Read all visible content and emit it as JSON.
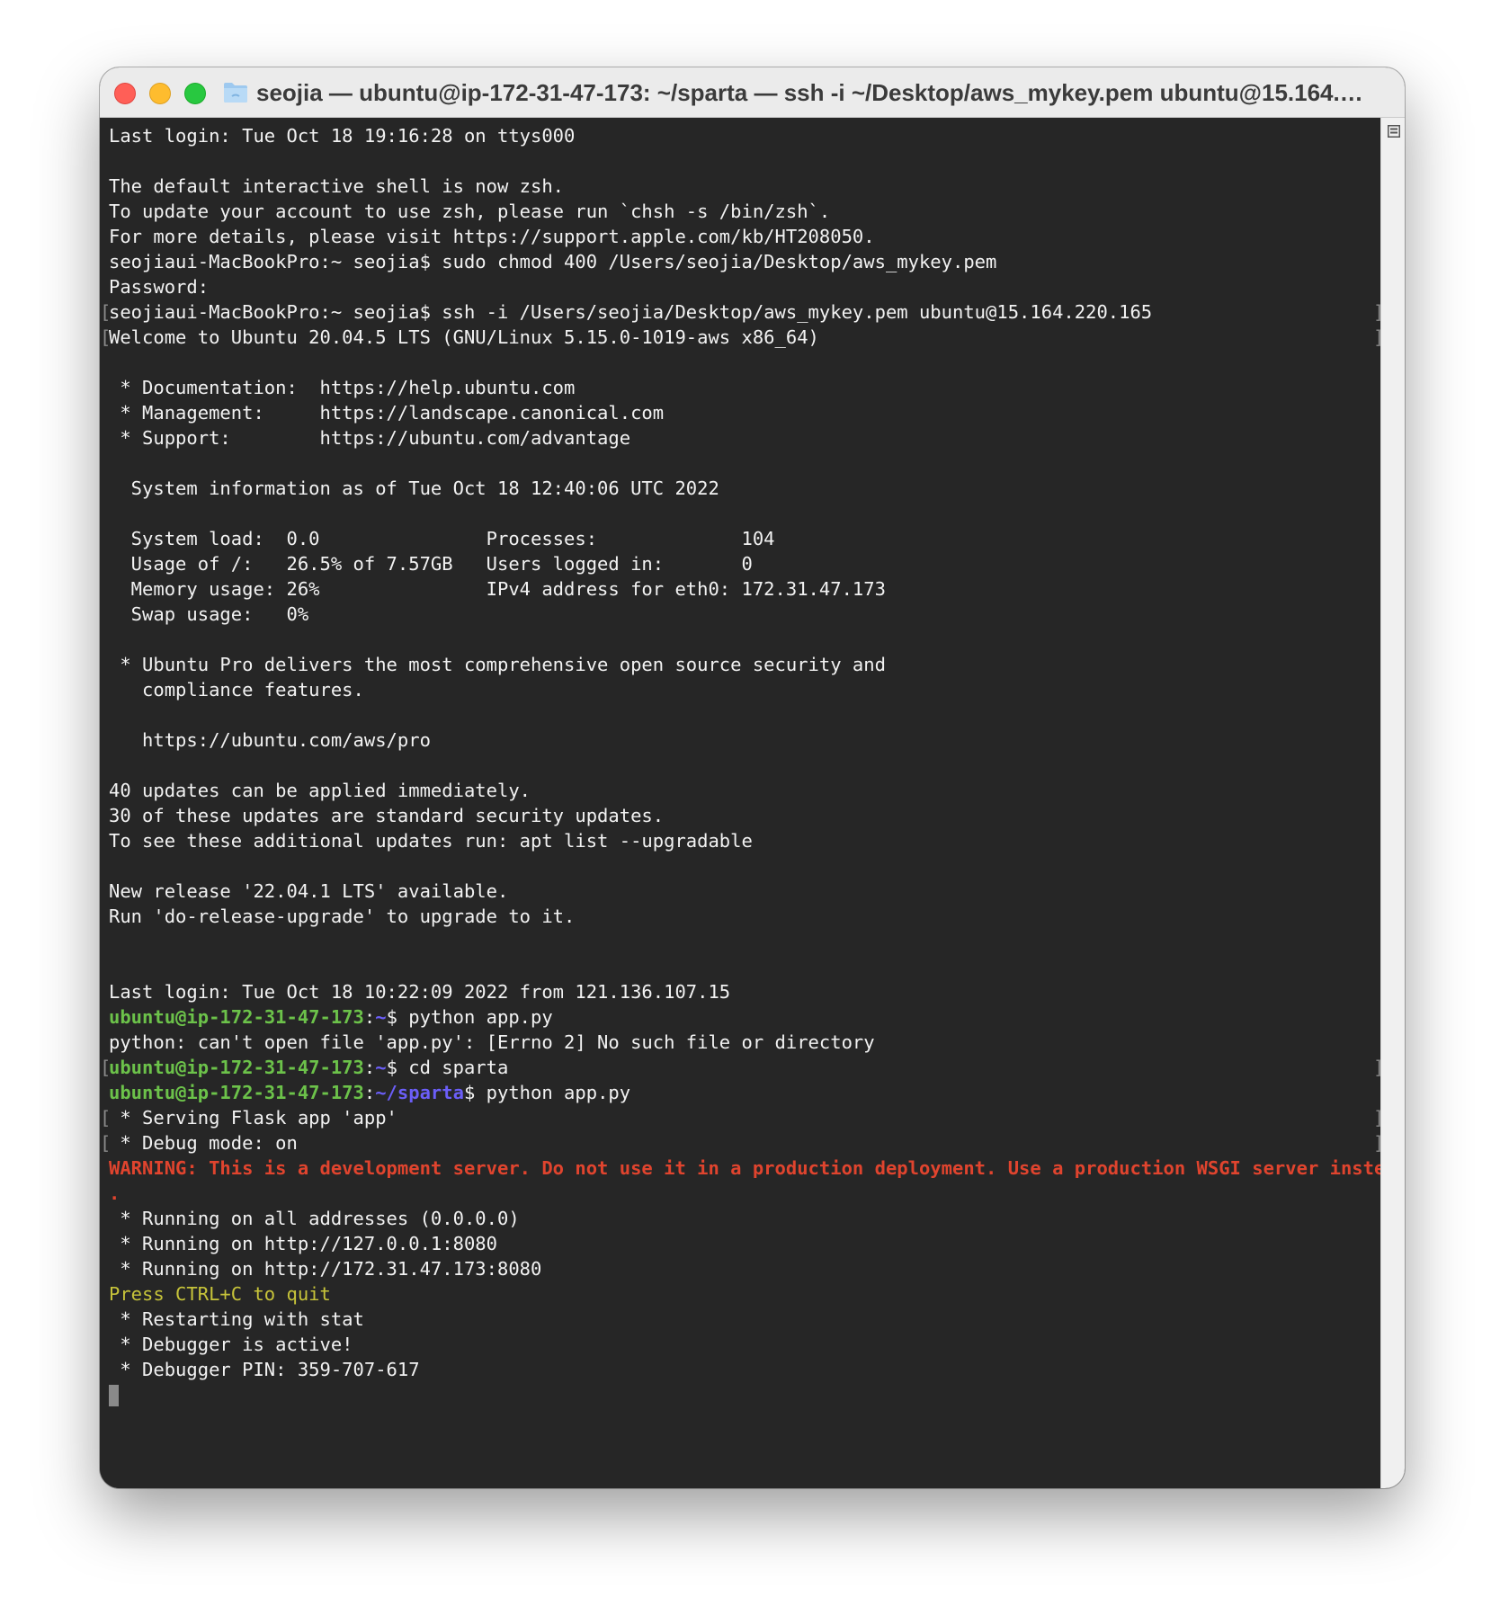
{
  "window": {
    "title": "seojia — ubuntu@ip-172-31-47-173: ~/sparta — ssh -i ~/Desktop/aws_mykey.pem ubuntu@15.164.…",
    "folder_icon": "folder-icon",
    "bookmark_icon": "marks-list-icon"
  },
  "colors": {
    "prompt_user": "#6cc24a",
    "prompt_path": "#6b5ef8",
    "warning": "#e0442e",
    "press_ctrl_c": "#c7c43a",
    "background": "#262626",
    "foreground": "#f2f2f2"
  },
  "terminal": {
    "l01": "Last login: Tue Oct 18 19:16:28 on ttys000",
    "l02": "",
    "l03": "The default interactive shell is now zsh.",
    "l04": "To update your account to use zsh, please run `chsh -s /bin/zsh`.",
    "l05": "For more details, please visit https://support.apple.com/kb/HT208050.",
    "l06": "seojiaui-MacBookPro:~ seojia$ sudo chmod 400 /Users/seojia/Desktop/aws_mykey.pem",
    "l07": "Password:",
    "l08": "seojiaui-MacBookPro:~ seojia$ ssh -i /Users/seojia/Desktop/aws_mykey.pem ubuntu@15.164.220.165",
    "l09": "Welcome to Ubuntu 20.04.5 LTS (GNU/Linux 5.15.0-1019-aws x86_64)",
    "l10": "",
    "l11": " * Documentation:  https://help.ubuntu.com",
    "l12": " * Management:     https://landscape.canonical.com",
    "l13": " * Support:        https://ubuntu.com/advantage",
    "l14": "",
    "l15": "  System information as of Tue Oct 18 12:40:06 UTC 2022",
    "l16": "",
    "l17": "  System load:  0.0               Processes:             104",
    "l18": "  Usage of /:   26.5% of 7.57GB   Users logged in:       0",
    "l19": "  Memory usage: 26%               IPv4 address for eth0: 172.31.47.173",
    "l20": "  Swap usage:   0%",
    "l21": "",
    "l22": " * Ubuntu Pro delivers the most comprehensive open source security and",
    "l23": "   compliance features.",
    "l24": "",
    "l25": "   https://ubuntu.com/aws/pro",
    "l26": "",
    "l27": "40 updates can be applied immediately.",
    "l28": "30 of these updates are standard security updates.",
    "l29": "To see these additional updates run: apt list --upgradable",
    "l30": "",
    "l31": "New release '22.04.1 LTS' available.",
    "l32": "Run 'do-release-upgrade' to upgrade to it.",
    "l33": "",
    "l34": "",
    "l35": "Last login: Tue Oct 18 10:22:09 2022 from 121.136.107.15",
    "l36": {
      "user": "ubuntu@ip-172-31-47-173",
      "sep": ":",
      "path": "~",
      "cmd": "$ python app.py"
    },
    "l37": "python: can't open file 'app.py': [Errno 2] No such file or directory",
    "l38": {
      "user": "ubuntu@ip-172-31-47-173",
      "sep": ":",
      "path": "~",
      "cmd": "$ cd sparta"
    },
    "l39": {
      "user": "ubuntu@ip-172-31-47-173",
      "sep": ":",
      "path": "~/sparta",
      "cmd": "$ python app.py"
    },
    "l40": " * Serving Flask app 'app'",
    "l41": " * Debug mode: on",
    "l42": "WARNING: This is a development server. Do not use it in a production deployment. Use a production WSGI server instead",
    "l43": ".",
    "l44": " * Running on all addresses (0.0.0.0)",
    "l45": " * Running on http://127.0.0.1:8080",
    "l46": " * Running on http://172.31.47.173:8080",
    "l47": "Press CTRL+C to quit",
    "l48": " * Restarting with stat",
    "l49": " * Debugger is active!",
    "l50": " * Debugger PIN: 359-707-617"
  }
}
